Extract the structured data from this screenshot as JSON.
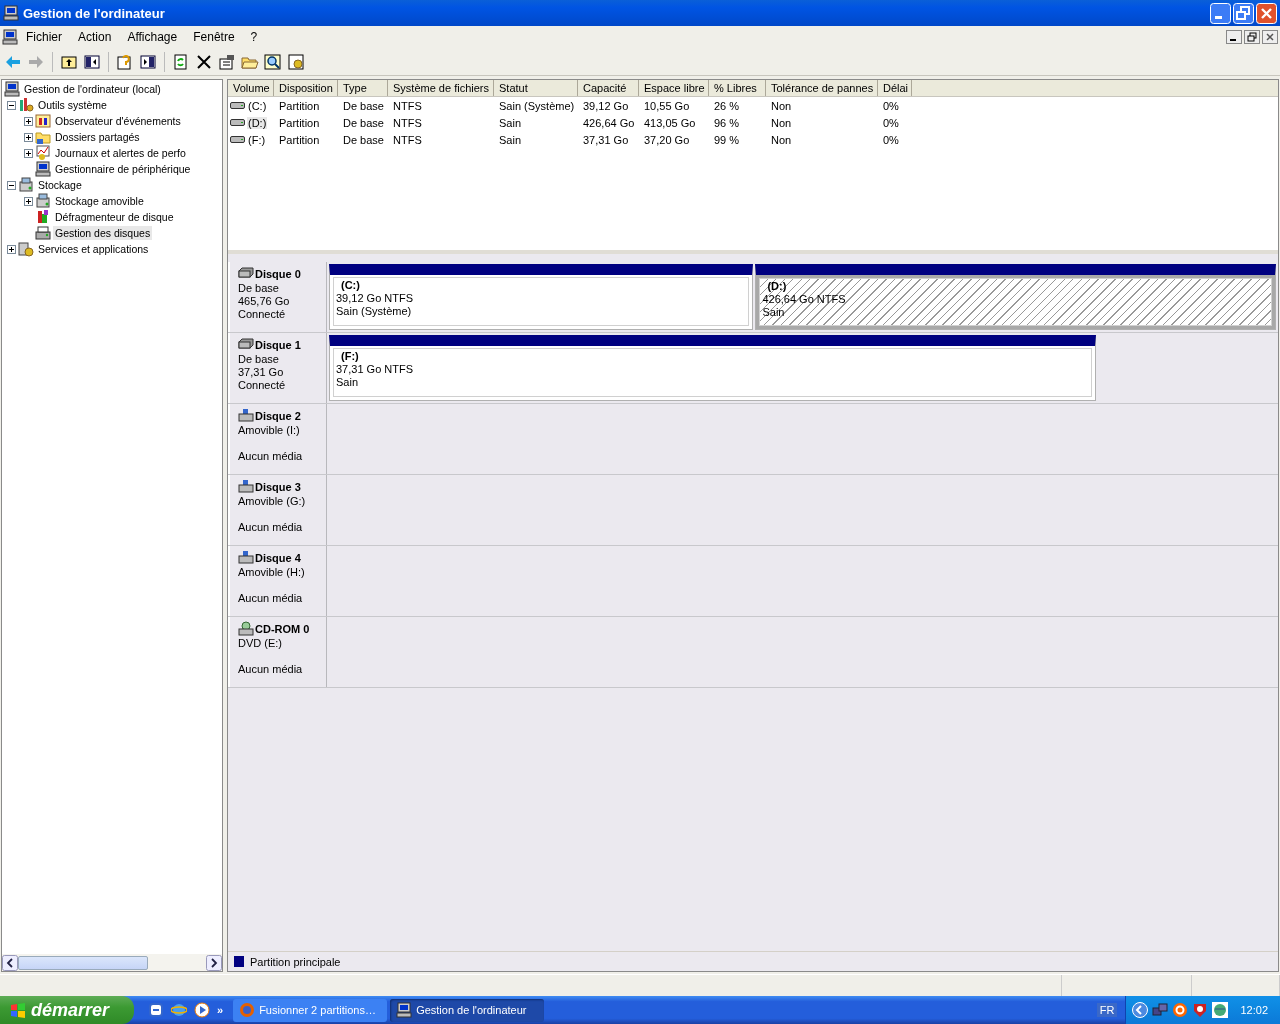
{
  "window": {
    "title": "Gestion de l'ordinateur"
  },
  "menu": [
    "Fichier",
    "Action",
    "Affichage",
    "Fenêtre",
    "?"
  ],
  "tree": [
    {
      "label": "Gestion de l'ordinateur (local)",
      "selected": false,
      "children": [
        {
          "label": "Outils système",
          "selected": false,
          "expanded": true,
          "children": [
            {
              "label": "Observateur d'événements",
              "selected": false,
              "expanded": false
            },
            {
              "label": "Dossiers partagés",
              "selected": false,
              "expanded": false
            },
            {
              "label": "Journaux et alertes de perfo",
              "selected": false,
              "expanded": false
            },
            {
              "label": "Gestionnaire de périphérique",
              "selected": false
            }
          ]
        },
        {
          "label": "Stockage",
          "selected": false,
          "expanded": true,
          "children": [
            {
              "label": "Stockage amovible",
              "selected": false,
              "expanded": false
            },
            {
              "label": "Défragmenteur de disque",
              "selected": false
            },
            {
              "label": "Gestion des disques",
              "selected": true
            }
          ]
        },
        {
          "label": "Services et applications",
          "selected": false,
          "expanded": false
        }
      ]
    }
  ],
  "table": {
    "columns": [
      "Volume",
      "Disposition",
      "Type",
      "Système de fichiers",
      "Statut",
      "Capacité",
      "Espace libre",
      "% Libres",
      "Tolérance de pannes",
      "Délai"
    ],
    "rows": [
      {
        "selected": false,
        "cells": [
          "(C:)",
          "Partition",
          "De base",
          "NTFS",
          "Sain (Système)",
          "39,12 Go",
          "10,55 Go",
          "26 %",
          "Non",
          "0%"
        ]
      },
      {
        "selected": true,
        "cells": [
          "(D:)",
          "Partition",
          "De base",
          "NTFS",
          "Sain",
          "426,64 Go",
          "413,05 Go",
          "96 %",
          "Non",
          "0%"
        ]
      },
      {
        "selected": false,
        "cells": [
          "(F:)",
          "Partition",
          "De base",
          "NTFS",
          "Sain",
          "37,31 Go",
          "37,20 Go",
          "99 %",
          "Non",
          "0%"
        ]
      }
    ]
  },
  "disks": [
    {
      "name": "Disque 0",
      "kind": "fixed",
      "lines": [
        "De base",
        "465,76 Go",
        "Connecté"
      ],
      "partitions": [
        {
          "label": "(C:)",
          "size": "39,12 Go NTFS",
          "status": "Sain (Système)",
          "selected": false
        },
        {
          "label": "(D:)",
          "size": "426,64 Go NTFS",
          "status": "Sain",
          "selected": true
        }
      ]
    },
    {
      "name": "Disque 1",
      "kind": "fixed",
      "lines": [
        "De base",
        "37,31 Go",
        "Connecté"
      ],
      "partitions": [
        {
          "label": "(F:)",
          "size": "37,31 Go NTFS",
          "status": "Sain",
          "selected": false
        }
      ]
    },
    {
      "name": "Disque 2",
      "kind": "removable",
      "lines": [
        "Amovible (I:)",
        "Aucun média"
      ]
    },
    {
      "name": "Disque 3",
      "kind": "removable",
      "lines": [
        "Amovible (G:)",
        "Aucun média"
      ]
    },
    {
      "name": "Disque 4",
      "kind": "removable",
      "lines": [
        "Amovible (H:)",
        "Aucun média"
      ]
    },
    {
      "name": "CD-ROM 0",
      "kind": "cdrom",
      "lines": [
        "DVD (E:)",
        "Aucun média"
      ]
    }
  ],
  "legend": [
    {
      "label": "Partition principale",
      "color": "#000080"
    }
  ],
  "taskbar": {
    "start": "démarrer",
    "more": "»",
    "tasks": [
      {
        "label": "Fusionner 2 partitions…",
        "selected": false
      },
      {
        "label": "Gestion de l'ordinateur",
        "selected": true
      }
    ],
    "language": "FR",
    "clock": "12:02"
  }
}
